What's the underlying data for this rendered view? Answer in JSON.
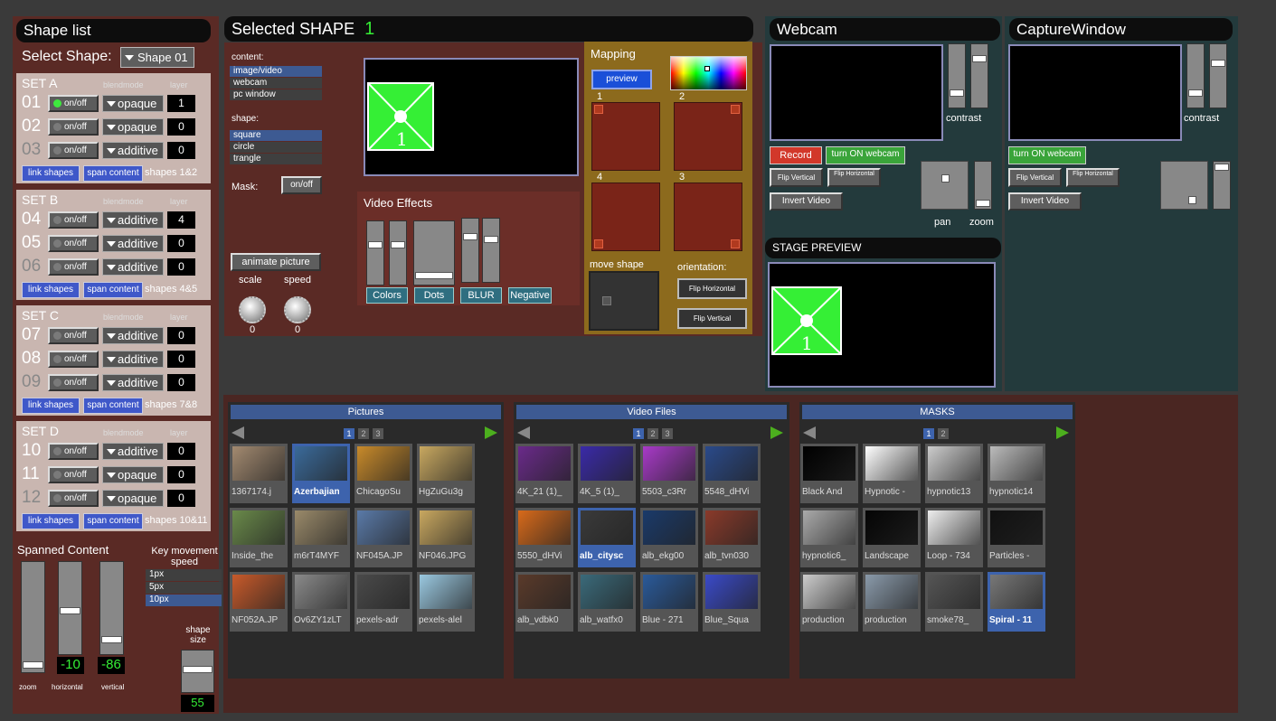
{
  "shape_list": {
    "title": "Shape list",
    "select_label": "Select Shape:",
    "select_value": "Shape 01",
    "col_blendmode": "blendmode",
    "col_layer": "layer",
    "sets": [
      {
        "name": "SET A",
        "footer_text": "shapes 1&2",
        "rows": [
          {
            "num": "01",
            "toggle": "on/off",
            "on": true,
            "blend": "opaque",
            "layer": "1"
          },
          {
            "num": "02",
            "toggle": "on/off",
            "on": false,
            "blend": "opaque",
            "layer": "0"
          },
          {
            "num": "03",
            "toggle": "on/off",
            "on": false,
            "blend": "additive",
            "layer": "0"
          }
        ]
      },
      {
        "name": "SET B",
        "footer_text": "shapes 4&5",
        "rows": [
          {
            "num": "04",
            "toggle": "on/off",
            "on": false,
            "blend": "additive",
            "layer": "4"
          },
          {
            "num": "05",
            "toggle": "on/off",
            "on": false,
            "blend": "additive",
            "layer": "0"
          },
          {
            "num": "06",
            "toggle": "on/off",
            "on": false,
            "blend": "additive",
            "layer": "0"
          }
        ]
      },
      {
        "name": "SET C",
        "footer_text": "shapes 7&8",
        "rows": [
          {
            "num": "07",
            "toggle": "on/off",
            "on": false,
            "blend": "additive",
            "layer": "0"
          },
          {
            "num": "08",
            "toggle": "on/off",
            "on": false,
            "blend": "additive",
            "layer": "0"
          },
          {
            "num": "09",
            "toggle": "on/off",
            "on": false,
            "blend": "additive",
            "layer": "0"
          }
        ]
      },
      {
        "name": "SET D",
        "footer_text": "shapes 10&11",
        "rows": [
          {
            "num": "10",
            "toggle": "on/off",
            "on": false,
            "blend": "additive",
            "layer": "0"
          },
          {
            "num": "11",
            "toggle": "on/off",
            "on": false,
            "blend": "opaque",
            "layer": "0"
          },
          {
            "num": "12",
            "toggle": "on/off",
            "on": false,
            "blend": "opaque",
            "layer": "0"
          }
        ]
      }
    ],
    "link_label": "link shapes",
    "span_label": "span content"
  },
  "spanned": {
    "title": "Spanned Content",
    "zoom_label": "zoom",
    "horizontal_label": "horizontal",
    "vertical_label": "vertical",
    "horizontal_value": "-10",
    "vertical_value": "-86",
    "key_title": "Key movement speed",
    "key_options": [
      "1px",
      "5px",
      "10px"
    ],
    "key_selected": "10px",
    "shape_size_label": "shape size",
    "shape_size_value": "55"
  },
  "selected": {
    "title": "Selected SHAPE",
    "number": "1",
    "content_label": "content:",
    "content_options": [
      "image/video",
      "webcam",
      "pc window"
    ],
    "shape_label": "shape:",
    "shape_options": [
      "square",
      "circle",
      "trangle"
    ],
    "mask_label": "Mask:",
    "mask_btn": "on/off",
    "animate_btn": "animate picture",
    "scale_label": "scale",
    "speed_label": "speed",
    "scale_value": "0",
    "speed_value": "0",
    "preview_number": "1",
    "video_effects_title": "Video Effects",
    "effects": [
      "Colors",
      "Dots",
      "BLUR",
      "Negative"
    ],
    "mapping_title": "Mapping",
    "preview_btn": "preview",
    "corners": [
      "1",
      "2",
      "4",
      "3"
    ],
    "move_shape_label": "move shape",
    "orientation_label": "orientation:",
    "flip_h": "Flip Horizontal",
    "flip_v": "Flip Vertical"
  },
  "webcam": {
    "title": "Webcam",
    "contrast_label": "contrast",
    "record_btn": "Record",
    "turn_on_btn": "turn ON webcam",
    "flip_v": "Flip Vertical",
    "flip_h": "Flip Horizontal",
    "invert_btn": "Invert Video",
    "pan_label": "pan",
    "zoom_label": "zoom"
  },
  "capture": {
    "title": "CaptureWindow",
    "contrast_label": "contrast",
    "turn_on_btn": "turn ON webcam",
    "flip_v": "Flip Vertical",
    "flip_h": "Flip Horizontal",
    "invert_btn": "Invert Video"
  },
  "stage": {
    "title": "STAGE PREVIEW",
    "preview_number": "1"
  },
  "browsers": [
    {
      "title": "Pictures",
      "pages": [
        "1",
        "2",
        "3"
      ],
      "active_page": "1",
      "items": [
        "1367174.j",
        "Azerbajian",
        "ChicagoSu",
        "HgZuGu3g",
        "Inside_the",
        "m6rT4MYF",
        "NF045A.JP",
        "NF046.JPG",
        "NF052A.JP",
        "Ov6ZY1zLT",
        "pexels-adr",
        "pexels-alel"
      ],
      "selected_index": 1
    },
    {
      "title": "Video Files",
      "pages": [
        "1",
        "2",
        "3"
      ],
      "active_page": "1",
      "items": [
        "4K_21 (1)_",
        "4K_5 (1)_",
        "5503_c3Rr",
        "5548_dHVi",
        "5550_dHVi",
        "alb_citysc",
        "alb_ekg00",
        "alb_tvn030",
        "alb_vdbk0",
        "alb_watfx0",
        "Blue - 271",
        "Blue_Squa"
      ],
      "selected_index": 5
    },
    {
      "title": "MASKS",
      "pages": [
        "1",
        "2"
      ],
      "active_page": "1",
      "items": [
        "Black And",
        "Hypnotic -",
        "hypnotic13",
        "hypnotic14",
        "hypnotic6_",
        "Landscape",
        "Loop - 734",
        "Particles -",
        "production",
        "production",
        "smoke78_",
        "Spiral - 11"
      ],
      "selected_index": 11
    }
  ],
  "colors": {
    "accent_green": "#35ef35",
    "panel_brown": "#5a2a25",
    "mapping_gold": "#8c6a1d",
    "link_blue": "#3f58c9"
  }
}
